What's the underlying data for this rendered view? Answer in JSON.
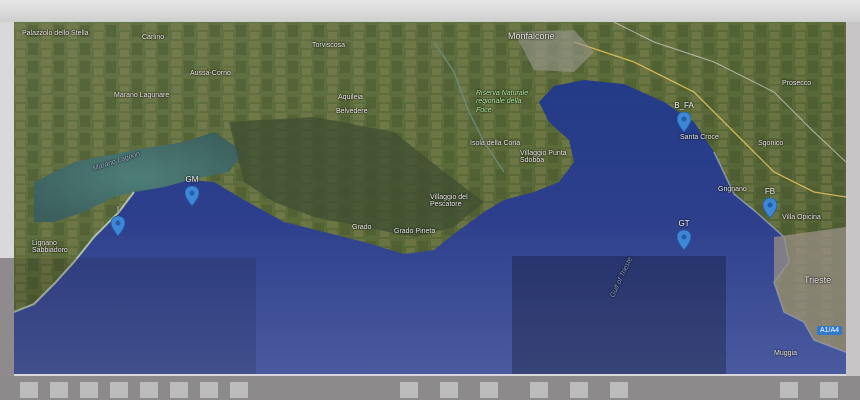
{
  "map": {
    "markers": [
      {
        "label": "I"
      },
      {
        "label": "GM"
      },
      {
        "label": "B_FA"
      },
      {
        "label": "FB"
      },
      {
        "label": "GT"
      }
    ],
    "places": {
      "palazzolo": "Palazzolo dello Stella",
      "carlino": "Carlino",
      "marano": "Marano Lagunare",
      "aussa": "Aussa-Corno",
      "torviscosa": "Torviscosa",
      "aquileia": "Aquileia",
      "belvedere": "Belvedere",
      "monfalcone": "Monfalcone",
      "riserva": "Riserva Naturale regionale della Foce",
      "isola_cona": "Isola della Cona",
      "punta_sdobba": "Villaggio Punta Sdobba",
      "villaggio_pescatore": "Villaggio del Pescatore",
      "grado_pineta": "Grado Pineta",
      "grado": "Grado",
      "lignano": "Lignano Sabbiadoro",
      "santa_croce": "Santa Croce",
      "prosecco": "Prosecco",
      "sgonico": "Sgonico",
      "grignano": "Grignano",
      "villa_opicina": "Villa Opicina",
      "trieste": "Trieste",
      "muggia": "Muggia",
      "marano_lagoon": "Marano Lagoon",
      "gulf": "Gulf of Trieste"
    },
    "badge": "A1/A4",
    "colors": {
      "sea": "#2c3f86",
      "land": "#5d6b3b",
      "marker": "#3e86d6"
    }
  }
}
